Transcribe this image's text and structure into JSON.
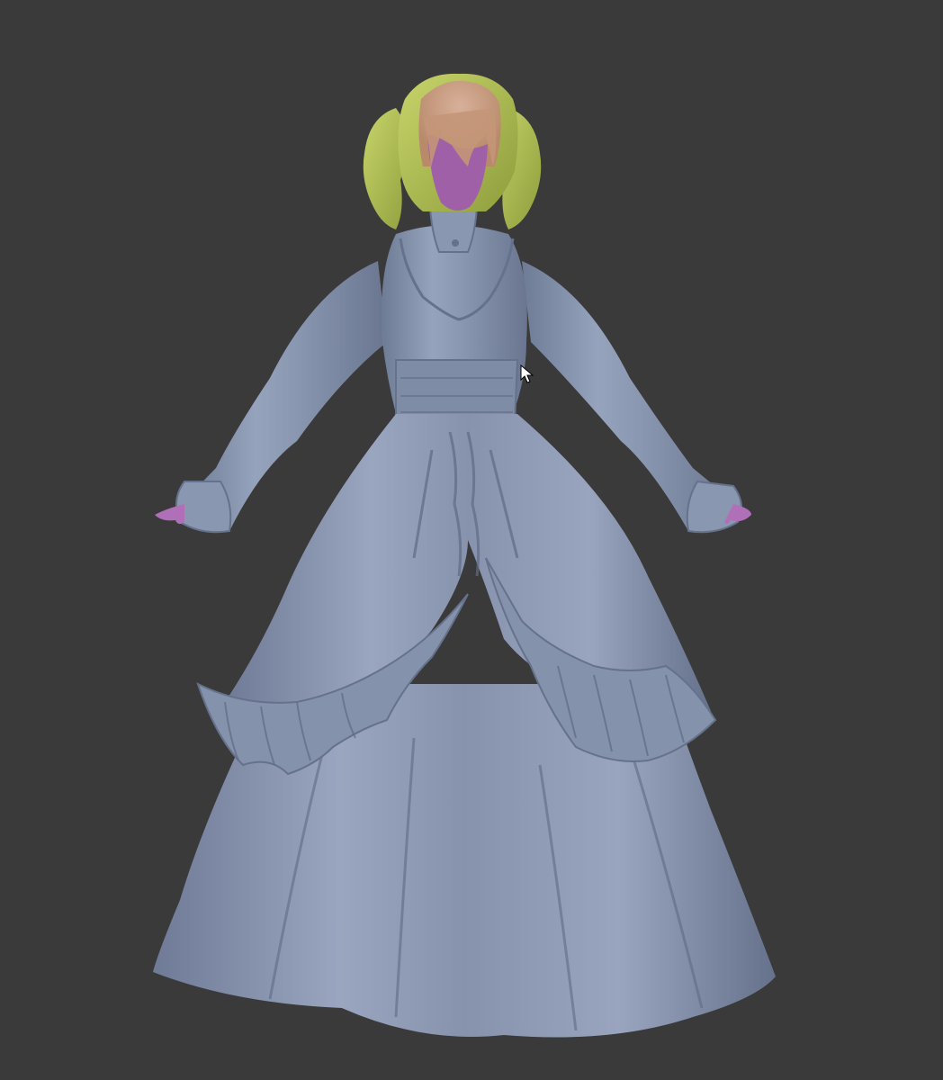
{
  "viewport": {
    "background": "#3a3a3a"
  },
  "model": {
    "subject": "character-sculpt",
    "colors": {
      "dress": "#8b98b3",
      "dress_shadow": "#6b7790",
      "dress_highlight": "#a9b4cb",
      "hair": "#b4c45a",
      "hair_shadow": "#8f9f3e",
      "hair_top": "#c9a080",
      "skin_face": "#a060a8",
      "skin_hands": "#b070b8"
    }
  },
  "cursor": {
    "icon": "mouse-pointer-icon"
  }
}
